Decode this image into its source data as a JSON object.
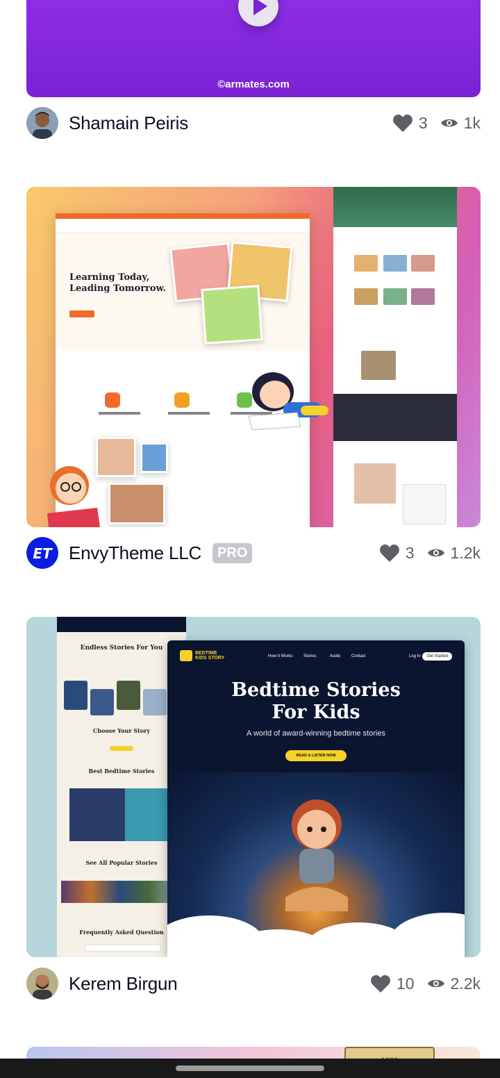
{
  "shots": [
    {
      "author": "Shamain Peiris",
      "likes": "3",
      "views": "1k",
      "watermark": "©armates.com",
      "accent": "#7a22d4"
    },
    {
      "author": "EnvyTheme LLC",
      "badge": "PRO",
      "likes": "3",
      "views": "1.2k",
      "preview": {
        "hero_title_1": "Learning Today,",
        "hero_title_2": "Leading Tomorrow."
      }
    },
    {
      "author": "Kerem Birgun",
      "likes": "10",
      "views": "2.2k",
      "preview": {
        "logo_line1": "BEDTIME",
        "logo_line2": "KIDS STORY",
        "nav": [
          "How It Works",
          "Stories",
          "Audio",
          "Contact",
          "Log In"
        ],
        "cta_nav": "Get Started",
        "title_line1": "Bedtime Stories",
        "title_line2": "For Kids",
        "subtitle": "A world of award-winning bedtime stories",
        "cta": "READ & LISTEN NOW",
        "left_headings": [
          "Endless Stories For You",
          "Choose Your Story",
          "Best Bedtime Stories",
          "See All Popular Stories",
          "Frequently Asked Question"
        ]
      }
    },
    {
      "preview": {
        "badge_text": "1200"
      }
    }
  ],
  "colors": {
    "heart": "#5e5e66",
    "pro_badge": "#c6c6cc",
    "envy_avatar": "#0a1de0"
  }
}
